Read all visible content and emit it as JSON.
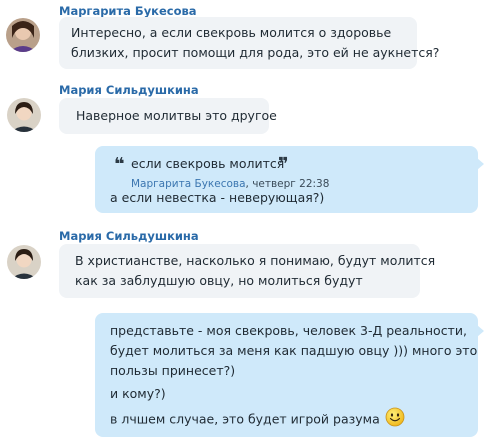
{
  "messages": [
    {
      "sender": "Маргарита Букесова",
      "lines": [
        "Интересно, а если свекровь молится о здоровье",
        "близких, просит помощи для рода, это ей не аукнется?"
      ]
    },
    {
      "sender": "Мария Сильдушкина",
      "lines": [
        "Наверное молитвы это другое"
      ]
    },
    {
      "quote": {
        "text": "если свекровь молится",
        "author": "Маргарита Букесова",
        "time": ", четверг 22:38"
      },
      "lines": [
        "а если невестка - неверующая?)"
      ]
    },
    {
      "sender": "Мария Сильдушкина",
      "lines": [
        "В христианстве, насколько я понимаю, будут молится",
        "как за заблудшую овцу, но молиться будут"
      ]
    },
    {
      "paragraphs": [
        [
          "представьте - моя свекровь, человек 3-Д реальности,",
          "будет молиться за меня как падшую овцу ))) много это",
          "пользы принесет?)"
        ],
        [
          "и кому?)"
        ],
        [
          "в лчшем случае, это будет игрой разума"
        ]
      ],
      "emoticon": "smile-emoticon"
    }
  ],
  "quote_marks": {
    "open": "❝",
    "close": "❞"
  },
  "colors": {
    "sender": "#2a6aa8",
    "incoming_bubble": "#f0f3f6",
    "outgoing_bubble": "#cfe9fa",
    "quote_author": "#3b76b0"
  }
}
